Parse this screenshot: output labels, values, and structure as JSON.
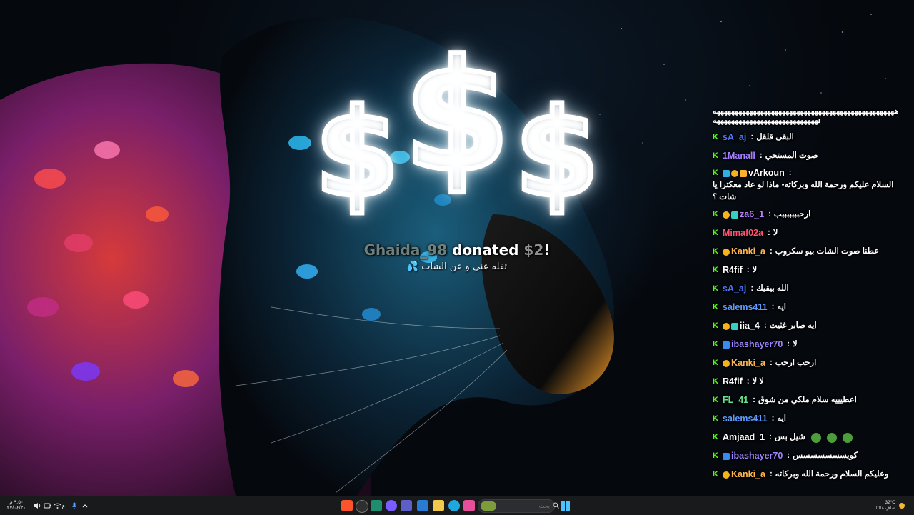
{
  "alert": {
    "username": "Ghaida_98",
    "donated_label": "donated",
    "amount": "$2",
    "exclamation": "!",
    "message": "تفله عني و عن الشات 💦",
    "dollar_signs": [
      "$",
      "$",
      "$"
    ]
  },
  "chat": {
    "banner_line_1": "ههههههههههههههههههههههههههههههههههههههههههههههههههه",
    "banner_line_2": "هههههههههههههههههههههههههههههه",
    "messages": [
      {
        "user": "sA_aj",
        "color": "#4d79ff",
        "badges": [],
        "text": "البقى قلقل"
      },
      {
        "user": "1Manall",
        "color": "#a57fff",
        "badges": [],
        "text": "صوت المستحي"
      },
      {
        "user": "vArkoun",
        "color": "#ffffff",
        "badges": [
          "gift",
          "sub",
          "og"
        ],
        "text": "السلام عليكم ورحمة الله وبركاته- ماذا لو عاد معكترا يا شات ؟"
      },
      {
        "user": "za6_1",
        "color": "#bb86fc",
        "badges": [
          "sub",
          "vip"
        ],
        "text": "ارحبببببببب"
      },
      {
        "user": "Mimaf02a",
        "color": "#ff5370",
        "badges": [],
        "text": "لا"
      },
      {
        "user": "Kanki_a",
        "color": "#ffb74d",
        "badges": [
          "sub"
        ],
        "text": "عطنا صوت الشات بيو سكروب"
      },
      {
        "user": "R4fif",
        "color": "#ffffff",
        "badges": [],
        "text": "لا"
      },
      {
        "user": "sA_aj",
        "color": "#4d79ff",
        "badges": [],
        "text": "الله بيقيك"
      },
      {
        "user": "salems411",
        "color": "#5c9cff",
        "badges": [],
        "text": "ايه"
      },
      {
        "user": "iia_4",
        "color": "#ffffff",
        "badges": [
          "sub",
          "vip"
        ],
        "text": "ايه صابر غثيث"
      },
      {
        "user": "ibashayer70",
        "color": "#9e85ff",
        "badges": [
          "verified"
        ],
        "text": "لا"
      },
      {
        "user": "Kanki_a",
        "color": "#ffb74d",
        "badges": [
          "sub"
        ],
        "text": "ارحب ارحب"
      },
      {
        "user": "R4fif",
        "color": "#ffffff",
        "badges": [],
        "text": "لا لا"
      },
      {
        "user": "FL_41",
        "color": "#66e08a",
        "badges": [],
        "text": "اعطيييه سلام ملكي من شوق"
      },
      {
        "user": "salems411",
        "color": "#5c9cff",
        "badges": [],
        "text": "ايه"
      },
      {
        "user": "Amjaad_1",
        "color": "#ffffff",
        "badges": [],
        "text": "شيل بس",
        "emotes": 3
      },
      {
        "user": "ibashayer70",
        "color": "#9e85ff",
        "badges": [
          "verified"
        ],
        "text": "كويسسسسسسس"
      },
      {
        "user": "Kanki_a",
        "color": "#ffb74d",
        "badges": [
          "sub"
        ],
        "text": "وعليكم السلام ورحمة الله وبركاته"
      }
    ]
  },
  "taskbar": {
    "clock_time": "٩:٥٠ م",
    "clock_date": "٢٧/٠٤/٢٠",
    "language": "ع",
    "search_placeholder": "بحث",
    "weather_temp": "32°C",
    "weather_desc": "صافٍ غالبًا"
  }
}
